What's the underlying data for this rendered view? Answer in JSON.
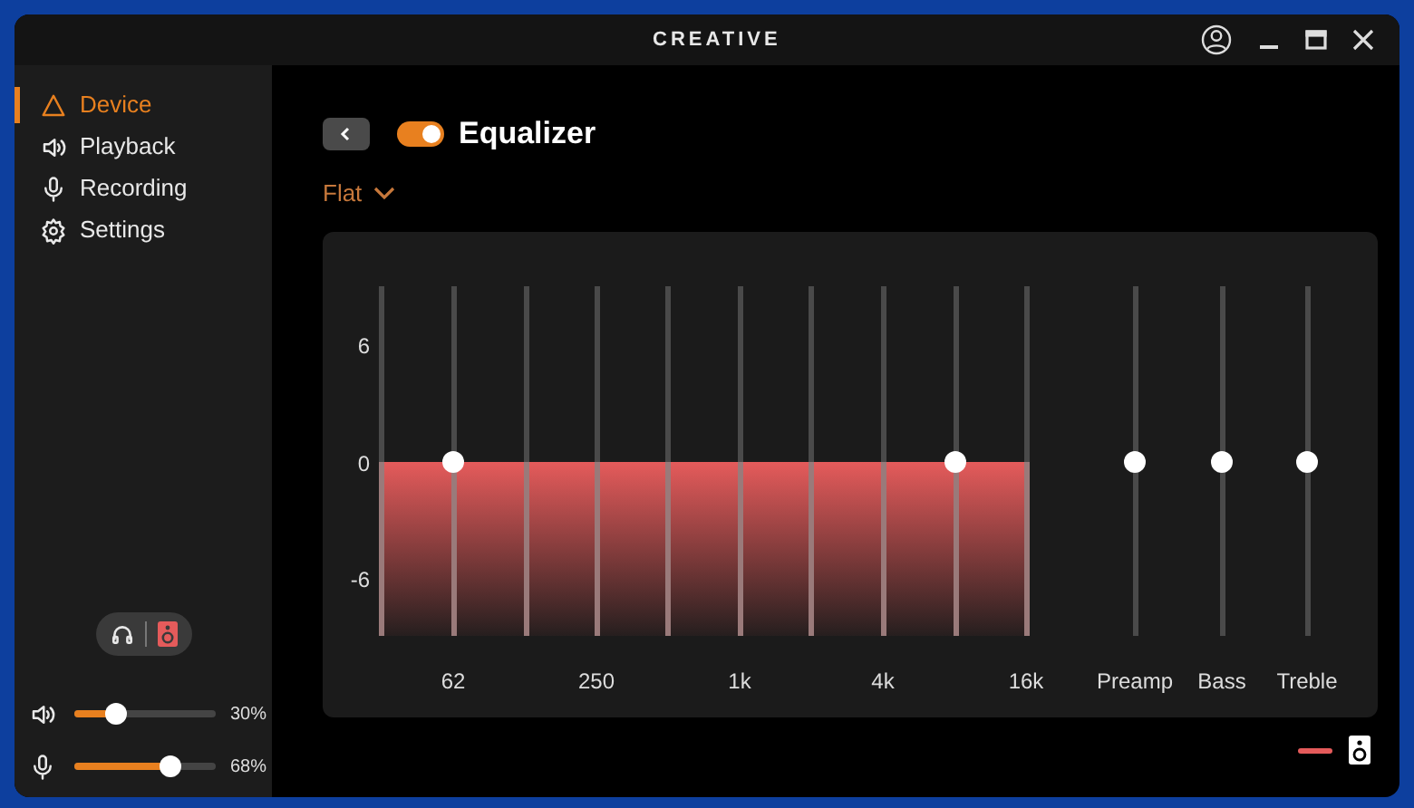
{
  "window": {
    "logo": "CREATIVE"
  },
  "sidebar": {
    "items": [
      {
        "kind": "device",
        "label": "Device",
        "selected": true
      },
      {
        "kind": "playback",
        "label": "Playback",
        "selected": false
      },
      {
        "kind": "recording",
        "label": "Recording",
        "selected": false
      },
      {
        "kind": "settings",
        "label": "Settings",
        "selected": false
      }
    ],
    "outputs": [
      {
        "kind": "headphones",
        "selected": false
      },
      {
        "kind": "speaker",
        "selected": true
      }
    ],
    "volumes": [
      {
        "kind": "speaker",
        "level": 0.3,
        "reading": "30%"
      },
      {
        "kind": "microphone",
        "level": 0.68,
        "reading": "68%"
      }
    ]
  },
  "header": {
    "title": "Equalizer",
    "on": true,
    "preset": "Flat"
  },
  "eq": {
    "axis": [
      "6",
      "0",
      "-6"
    ],
    "bands": [
      {
        "level": 0.5,
        "handle": false
      },
      {
        "level": 0.5,
        "handle": true,
        "label": "62"
      },
      {
        "level": 0.5,
        "handle": false
      },
      {
        "level": 0.5,
        "handle": false,
        "label": "250"
      },
      {
        "level": 0.5,
        "handle": false
      },
      {
        "level": 0.5,
        "handle": false,
        "label": "1k"
      },
      {
        "level": 0.5,
        "handle": false
      },
      {
        "level": 0.5,
        "handle": false,
        "label": "4k"
      },
      {
        "level": 0.5,
        "handle": true
      },
      {
        "level": 0.5,
        "handle": false,
        "label": "16k"
      }
    ],
    "extras": [
      {
        "label": "Preamp",
        "level": 0.5
      },
      {
        "label": "Bass",
        "level": 0.5
      },
      {
        "label": "Treble",
        "level": 0.5
      }
    ]
  },
  "legend": {
    "color": "#e55b5b"
  }
}
